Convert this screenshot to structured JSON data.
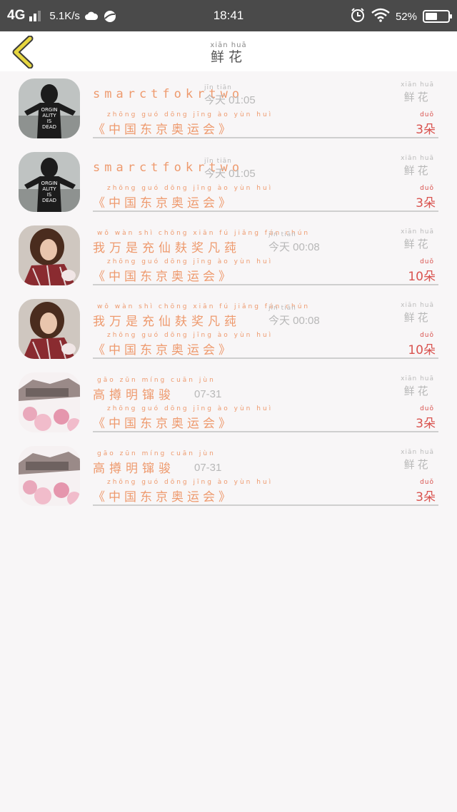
{
  "status_bar": {
    "network": "4G",
    "speed": "5.1K/s",
    "time": "18:41",
    "battery": "52%",
    "battery_level": 0.52
  },
  "header": {
    "title_pinyin": "xiān  huā",
    "title": "鲜花"
  },
  "records": [
    {
      "sender": "smarctfokrtwo",
      "time_pinyin": "jīn  tiān",
      "time": "今天 01:05",
      "gift_pinyin": "xiān  huā",
      "gift": "鲜花",
      "event_pinyin": "zhōng guó dōng jīng  ào  yùn  huì",
      "event": "《中国东京奥运会》",
      "qty_pinyin": "duǒ",
      "quantity": "3朵",
      "avatar": "hoodie-photo"
    },
    {
      "sender": "smarctfokrtwo",
      "time_pinyin": "jīn  tiān",
      "time": "今天 01:05",
      "gift_pinyin": "xiān  huā",
      "gift": "鲜花",
      "event_pinyin": "zhōng guó dōng jīng  ào  yùn  huì",
      "event": "《中国东京奥运会》",
      "qty_pinyin": "duǒ",
      "quantity": "3朵",
      "avatar": "hoodie-photo"
    },
    {
      "sender_pinyin": "wǒ  wàn  shì chōng xiān  fú   jiǎng fán chún",
      "sender": "我万是充仙麸奖凡莼",
      "time_pinyin": "jīn  tiān",
      "time": "今天 00:08",
      "gift_pinyin": "xiān  huā",
      "gift": "鲜花",
      "event_pinyin": "zhōng guó dōng jīng  ào  yùn  huì",
      "event": "《中国东京奥运会》",
      "qty_pinyin": "duǒ",
      "quantity": "10朵",
      "avatar": "woman-photo"
    },
    {
      "sender_pinyin": "wǒ  wàn  shì chōng xiān  fú   jiǎng fán chún",
      "sender": "我万是充仙麸奖凡莼",
      "time_pinyin": "jīn  tiān",
      "time": "今天 00:08",
      "gift_pinyin": "xiān  huā",
      "gift": "鲜花",
      "event_pinyin": "zhōng guó dōng jīng  ào  yùn  huì",
      "event": "《中国东京奥运会》",
      "qty_pinyin": "duǒ",
      "quantity": "10朵",
      "avatar": "woman-photo"
    },
    {
      "sender_pinyin": "gāo  zūn  míng  cuān  jùn",
      "sender": "高撙明镩骏",
      "time": "07-31",
      "gift_pinyin": "xiān  huā",
      "gift": "鲜花",
      "event_pinyin": "zhōng guó dōng jīng  ào  yùn  huì",
      "event": "《中国东京奥运会》",
      "qty_pinyin": "duǒ",
      "quantity": "3朵",
      "avatar": "blossom-photo"
    },
    {
      "sender_pinyin": "gāo  zūn  míng  cuān  jùn",
      "sender": "高撙明镩骏",
      "time": "07-31",
      "gift_pinyin": "xiān  huā",
      "gift": "鲜花",
      "event_pinyin": "zhōng guó dōng jīng  ào  yùn  huì",
      "event": "《中国东京奥运会》",
      "qty_pinyin": "duǒ",
      "quantity": "3朵",
      "avatar": "blossom-photo"
    }
  ],
  "colors": {
    "accent": "#ee9a6e",
    "quantity": "#d9534f",
    "back_arrow": "#e6d640"
  }
}
